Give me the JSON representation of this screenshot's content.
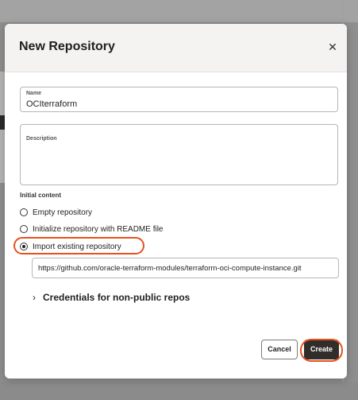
{
  "dialog": {
    "title": "New Repository",
    "close_glyph": "✕",
    "name_field": {
      "label": "Name",
      "value": "OCIterraform"
    },
    "description_field": {
      "label": "Description",
      "value": ""
    },
    "initial_content_label": "Initial content",
    "options": [
      {
        "label": "Empty repository",
        "checked": false
      },
      {
        "label": "Initialize repository with README file",
        "checked": false
      },
      {
        "label": "Import existing repository",
        "checked": true
      }
    ],
    "import_url": "https://github.com/oracle-terraform-modules/terraform-oci-compute-instance.git",
    "credentials": {
      "label": "Credentials for non-public repos",
      "chevron_glyph": "›"
    },
    "buttons": {
      "cancel": "Cancel",
      "create": "Create"
    }
  },
  "icons": {
    "close": "close-icon",
    "chevron": "chevron-right-icon"
  },
  "colors": {
    "accent_highlight": "#e8501e",
    "primary_button": "#312d2a",
    "header_bg": "#f4f3f1"
  }
}
